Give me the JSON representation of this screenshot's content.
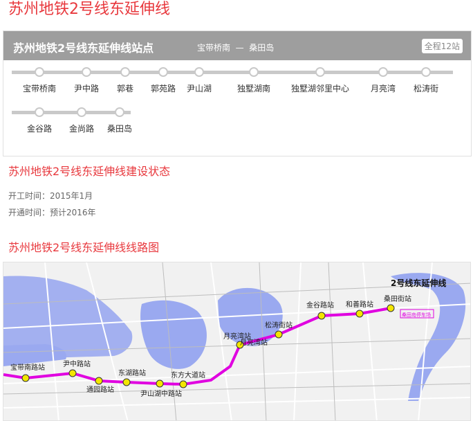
{
  "page": {
    "title": "苏州地铁2号线东延伸线"
  },
  "stations_panel": {
    "title": "苏州地铁2号线东延伸线站点",
    "route_from": "宝带桥南",
    "route_dash": "—",
    "route_to": "桑田岛",
    "count_badge": "全程12站",
    "stations": [
      "宝带桥南",
      "尹中路",
      "郭巷",
      "郭苑路",
      "尹山湖",
      "独墅湖南",
      "独墅湖邻里中心",
      "月亮湾",
      "松涛街",
      "金谷路",
      "金尚路",
      "桑田岛"
    ]
  },
  "status_section": {
    "title": "苏州地铁2号线东延伸线建设状态",
    "start_line": "开工时间：2015年1月",
    "open_line": "开通时间：预计2016年"
  },
  "map_section": {
    "title": "苏州地铁2号线东延伸线线路图",
    "map_heading": "2号线东延伸线",
    "labels": [
      "宝带南路站",
      "尹中路站",
      "通园路站",
      "东湖路站",
      "尹山湖中路站",
      "东方大道站",
      "月亮湾站",
      "松涛街站",
      "金谷路站",
      "和善路站",
      "桑田街站",
      "桑田岛停车场"
    ],
    "colors": {
      "line": "#e000e0",
      "water": "#9aa9f0",
      "station": "#f3e600"
    }
  }
}
